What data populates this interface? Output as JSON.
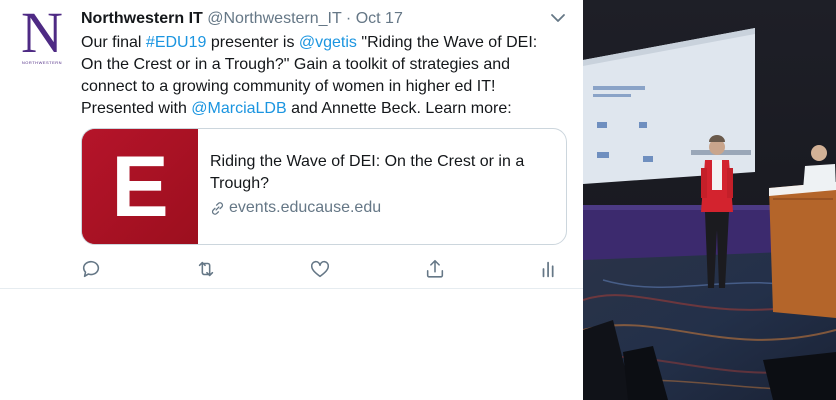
{
  "tweet": {
    "avatar_letter": "N",
    "avatar_caption": "NORTHWESTERN",
    "author_name": "Northwestern IT",
    "author_handle": "@Northwestern_IT",
    "separator": "·",
    "date": "Oct 17",
    "text": {
      "l1_a": "Our final ",
      "l1_hashtag": "#EDU19",
      "l1_b": " presenter is ",
      "l1_mention": "@vgetis",
      "l1_c": " \"Riding the Wave of DEI:",
      "l2": "On the Crest or in a Trough?\" Gain a toolkit of strategies and",
      "l3": "connect to a growing community of women in higher ed IT!",
      "l4_a": "Presented with ",
      "l4_mention": "@MarciaLDB",
      "l4_b": " and Annette Beck. Learn more:"
    },
    "card": {
      "thumb_letter": "E",
      "title": "Riding the Wave of DEI: On the Crest or in a Trough?",
      "domain": "events.educause.edu"
    },
    "actions": [
      "reply-icon",
      "retweet-icon",
      "like-icon",
      "share-icon",
      "analytics-icon"
    ]
  },
  "colors": {
    "link": "#1b95e0",
    "secondary_text": "#657786",
    "brand_purple": "#4e2a84",
    "card_thumb": "#a3101f"
  },
  "photo": {
    "description_icon": "conference-photo"
  }
}
